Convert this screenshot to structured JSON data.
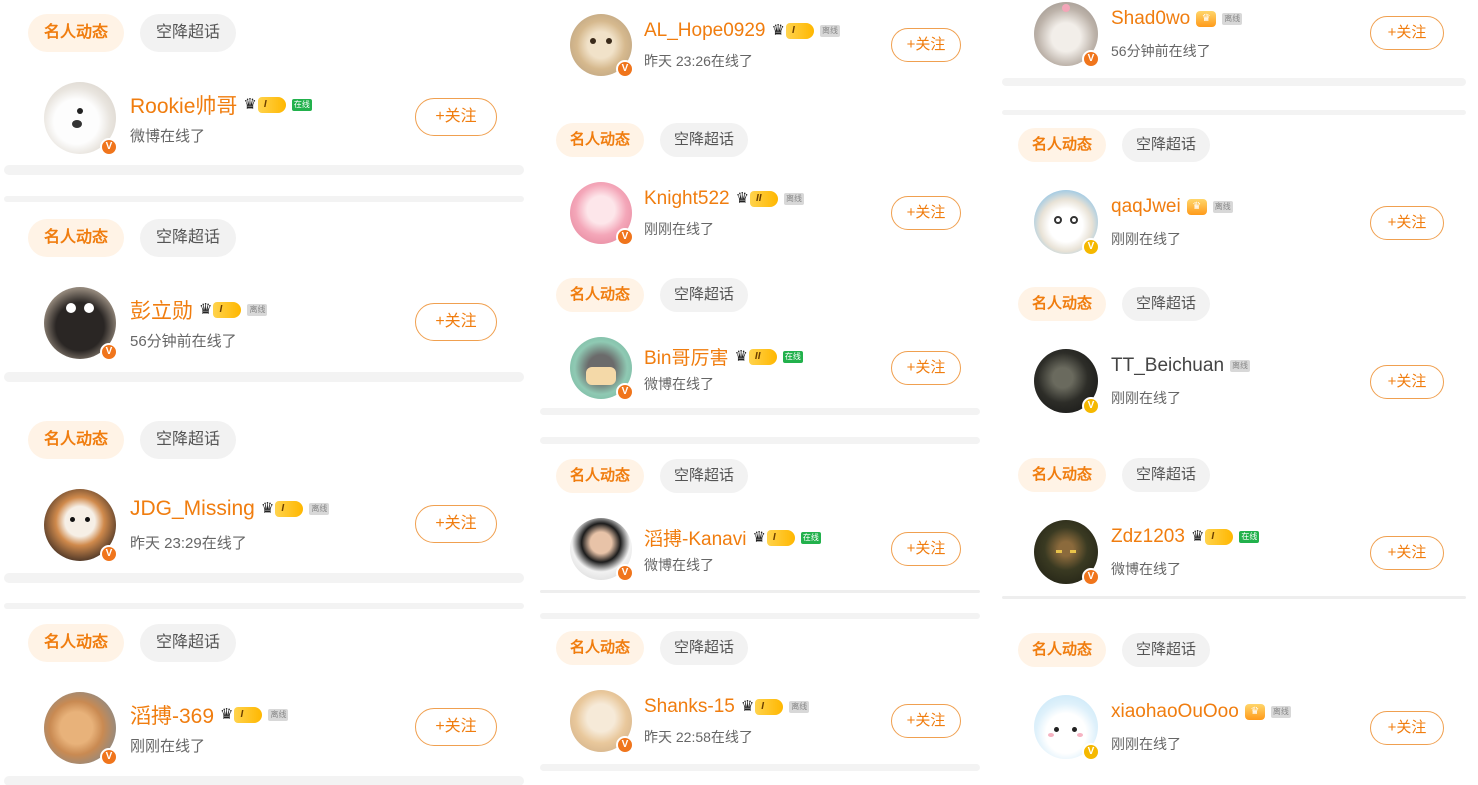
{
  "labels": {
    "celeb_feed": "名人动态",
    "airdrop_topic": "空降超话",
    "follow": "+关注"
  },
  "colors": {
    "accent": "#f07d0f",
    "chip_celeb_bg": "#fff3e6",
    "chip_air_bg": "#f2f2f2",
    "online_tag": "#22b14c",
    "verified_orange": "#f0751c",
    "verified_gold": "#f5b800"
  },
  "columns": [
    {
      "users": [
        {
          "name": "Rookie帅哥",
          "status": "微博在线了",
          "level": "I",
          "presence": "在线",
          "badge": "orange",
          "avatar": "white-dog-avatar"
        },
        {
          "name": "彭立勋",
          "status": "56分钟前在线了",
          "level": "I",
          "presence": "离线",
          "badge": "orange",
          "avatar": "black-plush-avatar"
        },
        {
          "name": "JDG_Missing",
          "status": "昨天 23:29在线了",
          "level": "I",
          "presence": "离线",
          "badge": "orange",
          "avatar": "corgi-avatar"
        },
        {
          "name": "滔搏-369",
          "status": "刚刚在线了",
          "level": "I",
          "presence": "离线",
          "badge": "orange",
          "avatar": "shiba-avatar"
        }
      ]
    },
    {
      "users": [
        {
          "name": "AL_Hope0929",
          "status": "昨天 23:26在线了",
          "level": "I",
          "presence": "离线",
          "badge": "orange",
          "avatar": "cat-avatar"
        },
        {
          "name": "Knight522",
          "status": "刚刚在线了",
          "level": "II",
          "presence": "离线",
          "badge": "orange",
          "avatar": "anime-girl-avatar"
        },
        {
          "name": "Bin哥厉害",
          "status": "微博在线了",
          "level": "II",
          "presence": "在线",
          "badge": "orange",
          "avatar": "cartoon-avatar"
        },
        {
          "name": "滔搏-Kanavi",
          "status": "微博在线了",
          "level": "I",
          "presence": "在线",
          "badge": "orange",
          "avatar": "player-photo-avatar"
        },
        {
          "name": "Shanks-15",
          "status": "昨天 22:58在线了",
          "level": "I",
          "presence": "离线",
          "badge": "orange",
          "avatar": "anime-blonde-avatar"
        }
      ]
    },
    {
      "users": [
        {
          "name": "Shad0wo",
          "status": "56分钟前在线了",
          "level": "",
          "presence": "离线",
          "badge": "orange",
          "avatar": "kitten-avatar"
        },
        {
          "name": "qaqJwei",
          "status": "刚刚在线了",
          "level": "",
          "presence": "离线",
          "badge": "gold",
          "avatar": "sheep-cartoon-avatar"
        },
        {
          "name": "TT_Beichuan",
          "status": "刚刚在线了",
          "level": "",
          "presence": "离线",
          "badge": "gold",
          "avatar": "dark-portrait-avatar"
        },
        {
          "name": "Zdz1203",
          "status": "微博在线了",
          "level": "I",
          "presence": "在线",
          "badge": "orange",
          "avatar": "game-hero-avatar"
        },
        {
          "name": "xiaohaoOuOoo",
          "status": "刚刚在线了",
          "level": "",
          "presence": "离线",
          "badge": "gold",
          "avatar": "white-cat-cartoon-avatar"
        }
      ]
    }
  ]
}
